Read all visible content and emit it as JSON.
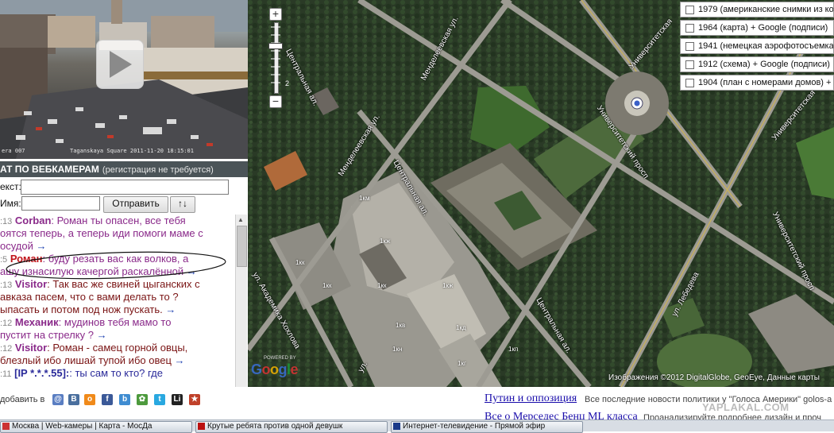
{
  "webcam": {
    "timestamp_left": "era 007",
    "timestamp_right": "Taganskaya Square 2011-11-20 18:15:01"
  },
  "chat": {
    "header_title": "АТ ПО ВЕБКАМЕРАМ",
    "header_note": "(регистрация не требуется)",
    "text_label": "екст:",
    "name_label": "Имя:",
    "send_label": "Отправить",
    "sort_label": "↑↓",
    "messages": [
      {
        "time": ":13",
        "user": "Corban",
        "user_color": "#8a2a8a",
        "color": "#8a2a8a",
        "lines": [
          "Роман ты опасен, все тебя",
          "оятся теперь, а теперь иди помоги маме с",
          "осудой"
        ]
      },
      {
        "time": ":5",
        "user": "Роман",
        "user_color": "#c0141a",
        "color": "#8a2a8a",
        "lines": [
          "буду резать вас как волков, а",
          "ашу изнасилую качергой раскалённой"
        ]
      },
      {
        "time": ":13",
        "user": "Visitor",
        "user_color": "#8a2a8a",
        "color": "#7a1414",
        "lines": [
          "Так вас же свиней цыганских с",
          "авказа пасем, что с вами делать то ?",
          "ыпасать и потом под нож пускать."
        ]
      },
      {
        "time": ":12",
        "user": "Механик",
        "user_color": "#8a2a8a",
        "color": "#8a2a8a",
        "lines": [
          "мудинов тебя мамо то",
          "пустит на стрелку ?"
        ]
      },
      {
        "time": ":12",
        "user": "Visitor",
        "user_color": "#8a2a8a",
        "color": "#7a1414",
        "lines": [
          "Роман - самец горной овцы,",
          "блезлый ибо лишай тупой ибо овец"
        ]
      },
      {
        "time": ":11",
        "user": "[IP *.*.*.55]:",
        "user_color": "#2a2a9a",
        "color": "#2a2a9a",
        "lines": [
          "ты сам то кто? где"
        ]
      }
    ],
    "arrow": "→"
  },
  "map": {
    "zoom_level": "2",
    "layers": [
      {
        "label": "1979 (американские снимки из ко",
        "checked": false
      },
      {
        "label": "1964 (карта) + Google (подписи)",
        "checked": false
      },
      {
        "label": "1941 (немецкая аэрофотосъемка",
        "checked": false
      },
      {
        "label": "1912 (схема) + Google (подписи)",
        "checked": false
      },
      {
        "label": "1904 (план с номерами домов) +",
        "checked": false
      }
    ],
    "streets": {
      "tsentralnaya_1": "Центральная ал.",
      "tsentralnaya_2": "Центральная ал.",
      "tsentralnaya_3": "Центральная ал.",
      "mendeleevskaya_1": "Менделеевская ул.",
      "mendeleevskaya_2": "Менделеевская ул.",
      "universitetsky_1": "Университетский просп",
      "universitetsky_2": "Университетский просп",
      "universitetskaya_1": "Университетская",
      "universitetskaya_2": "Университетская",
      "akademika_khokhlova": "ул. Академика Хохлова",
      "lebedeva": "ул. Лебедева",
      "ul_short": "ул."
    },
    "building_labels": {
      "b1": "1км",
      "b2": "1кж",
      "b3": "1кк",
      "b4": "1кк",
      "b5": "1кк",
      "b6": "1кж",
      "b7": "1кв",
      "b8": "1кн",
      "b9": "1кг",
      "b10": "1кп",
      "b11": "1кд"
    },
    "google_logo": "Google",
    "google_small": "POWERED BY",
    "attribution": "Изображения ©2012 DigitalGlobe, GeoEye, Данные карты"
  },
  "share": {
    "label": "добавить в"
  },
  "news": {
    "link1": "Путин и оппозиция",
    "desc1": "Все последние новости политики у \"Голоса Америки\" golos-a",
    "link2": "Все о Мерседес Бенц ML класса",
    "desc2": "Проанализируйте подробнее дизайн и проч"
  },
  "watermark": "YAPLAKAL.COM",
  "taskbar": {
    "tasks": [
      {
        "title": "Москва | Web-камеры | Карта - МосДа",
        "color": "#c33"
      },
      {
        "title": "Крутые ребята против одной девушк",
        "color": "#b11"
      },
      {
        "title": "Интернет-телевидение - Прямой эфир",
        "color": "#1a3a8a"
      }
    ]
  }
}
